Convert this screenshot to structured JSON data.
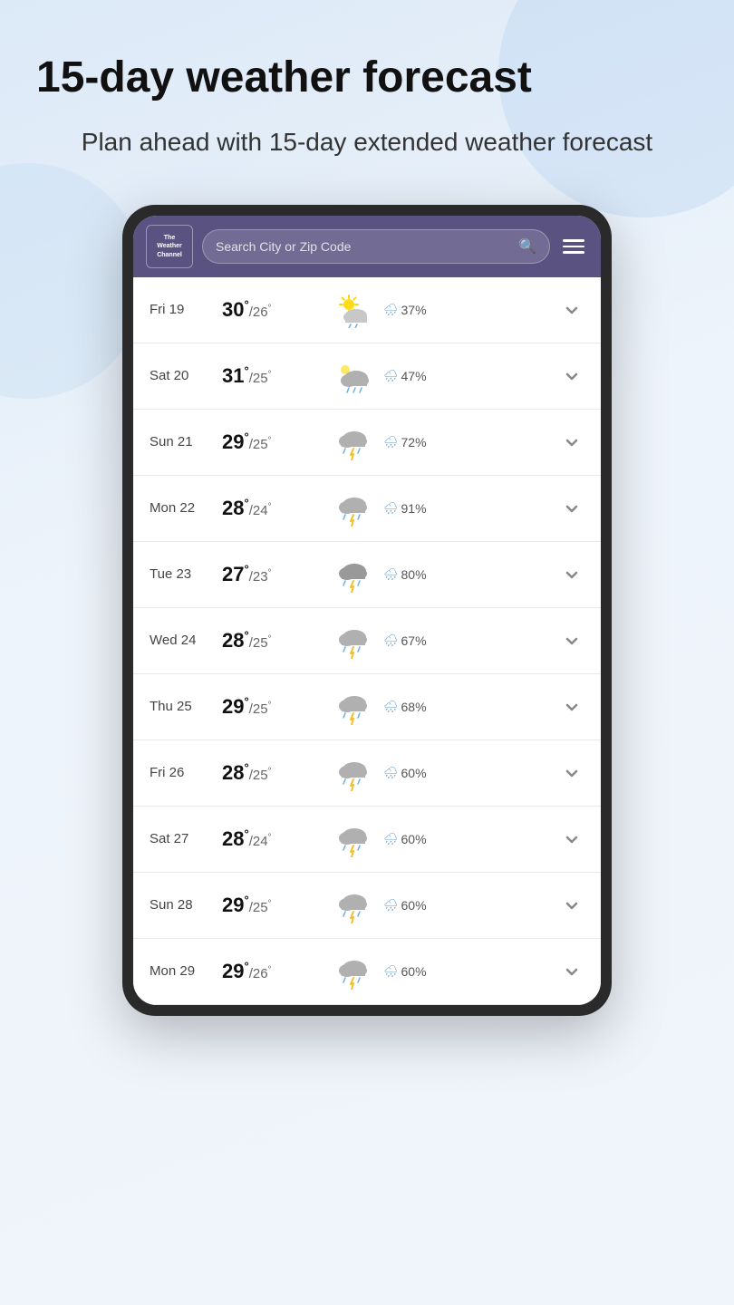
{
  "page": {
    "headline": "15-day weather forecast",
    "subtitle": "Plan ahead with 15-day extended weather forecast"
  },
  "app": {
    "logo_line1": "The",
    "logo_line2": "Weather",
    "logo_line3": "Channel",
    "search_placeholder": "Search City or Zip Code",
    "menu_label": "Menu"
  },
  "forecast": [
    {
      "day": "Fri 19",
      "high": "30",
      "low": "26",
      "icon": "partly-sunny-rain",
      "precip": "37%"
    },
    {
      "day": "Sat 20",
      "high": "31",
      "low": "25",
      "icon": "cloudy-rain",
      "precip": "47%"
    },
    {
      "day": "Sun 21",
      "high": "29",
      "low": "25",
      "icon": "thunder",
      "precip": "72%"
    },
    {
      "day": "Mon 22",
      "high": "28",
      "low": "24",
      "icon": "thunder",
      "precip": "91%"
    },
    {
      "day": "Tue 23",
      "high": "27",
      "low": "23",
      "icon": "thunder-heavy",
      "precip": "80%"
    },
    {
      "day": "Wed 24",
      "high": "28",
      "low": "25",
      "icon": "thunder",
      "precip": "67%"
    },
    {
      "day": "Thu 25",
      "high": "29",
      "low": "25",
      "icon": "thunder",
      "precip": "68%"
    },
    {
      "day": "Fri 26",
      "high": "28",
      "low": "25",
      "icon": "thunder",
      "precip": "60%"
    },
    {
      "day": "Sat 27",
      "high": "28",
      "low": "24",
      "icon": "thunder",
      "precip": "60%"
    },
    {
      "day": "Sun 28",
      "high": "29",
      "low": "25",
      "icon": "thunder",
      "precip": "60%"
    },
    {
      "day": "Mon 29",
      "high": "29",
      "low": "26",
      "icon": "thunder",
      "precip": "60%"
    }
  ]
}
